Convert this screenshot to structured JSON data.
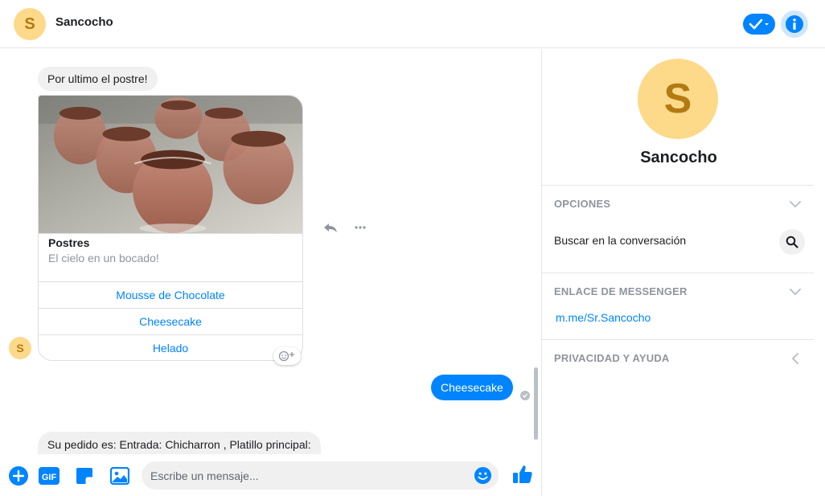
{
  "header": {
    "avatar_letter": "S",
    "title": "Sancocho",
    "check_icon": "check-dropdown-icon",
    "info_icon": "info-icon"
  },
  "conversation": {
    "message_1": "Por ultimo el postre!",
    "card": {
      "title": "Postres",
      "subtitle": "El cielo en un bocado!",
      "buttons": [
        "Mousse de Chocolate",
        "Cheesecake",
        "Helado"
      ]
    },
    "sender_avatar_letter": "S",
    "reply_user": "Cheesecake",
    "message_3": "Su pedido es: Entrada: Chicharron , Platillo principal: Filete Cordon con bistil"
  },
  "composer": {
    "placeholder": "Escribe un mensaje...",
    "icons": [
      "plus-icon",
      "gif-icon",
      "sticker-icon",
      "image-icon",
      "emoji-icon",
      "like-icon"
    ]
  },
  "details": {
    "avatar_letter": "S",
    "name": "Sancocho",
    "options_title": "OPCIONES",
    "search_label": "Buscar en la conversación",
    "messenger_link_title": "ENLACE DE MESSENGER",
    "messenger_link": "m.me/Sr.Sancocho",
    "privacy_title": "PRIVACIDAD Y AYUDA"
  },
  "colors": {
    "accent": "#0084ff",
    "avatar_bg": "#fdd98a",
    "avatar_fg": "#b37a12",
    "bubble_grey": "#f1f0f0"
  }
}
